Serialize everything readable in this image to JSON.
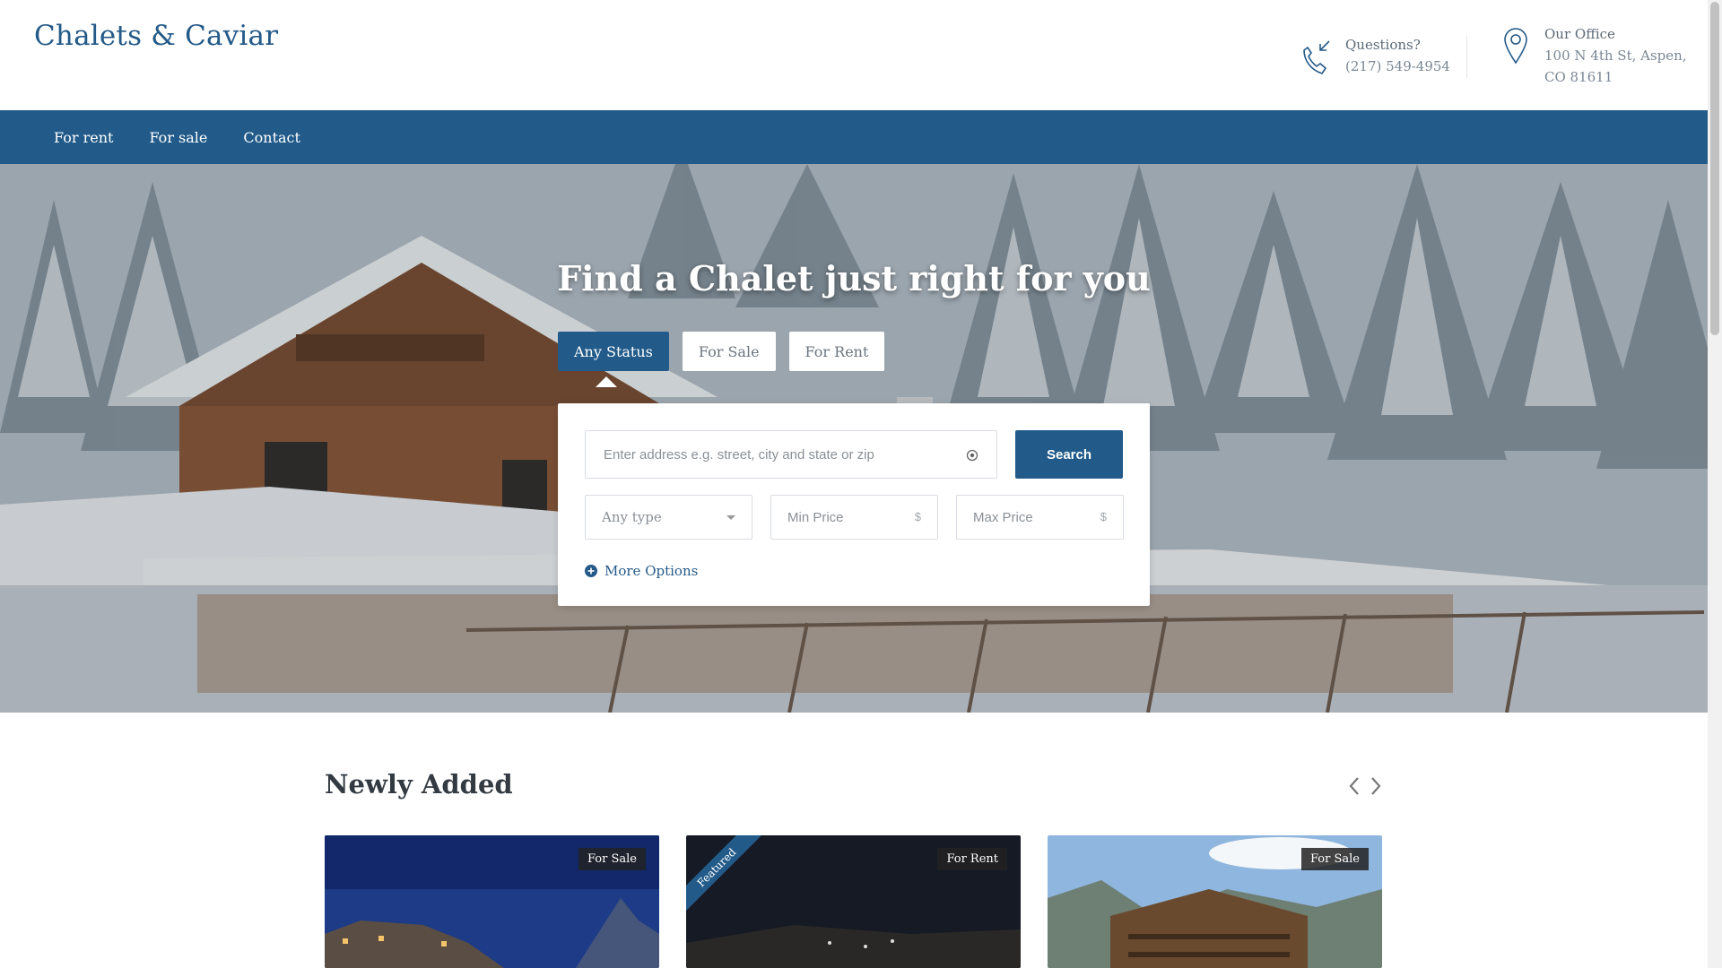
{
  "header": {
    "logo": "Chalets & Caviar",
    "phone": {
      "title": "Questions?",
      "number": "(217) 549-4954"
    },
    "office": {
      "title": "Our Office",
      "line1": "100 N 4th St, Aspen,",
      "line2": "CO 81611"
    }
  },
  "nav": {
    "items": [
      "For rent",
      "For sale",
      "Contact"
    ]
  },
  "hero": {
    "title": "Find a Chalet just right for you",
    "status_tabs": [
      "Any Status",
      "For Sale",
      "For Rent"
    ],
    "search": {
      "address_placeholder": "Enter address e.g. street, city and state or zip",
      "button": "Search",
      "type_placeholder": "Any type",
      "min_price": "Min Price",
      "max_price": "Max Price",
      "currency": "$",
      "more_options": "More Options"
    }
  },
  "listings": {
    "title": "Newly Added",
    "cards": [
      {
        "badge": "For Sale",
        "featured": ""
      },
      {
        "badge": "For Rent",
        "featured": "Featured"
      },
      {
        "badge": "For Sale",
        "featured": ""
      }
    ]
  },
  "colors": {
    "brand": "#225b8a",
    "logo": "#245a88"
  },
  "icons": {
    "phone": "phone-incoming-icon",
    "office": "map-pin-icon",
    "locate": "crosshair-icon",
    "more": "plus-circle-icon"
  }
}
